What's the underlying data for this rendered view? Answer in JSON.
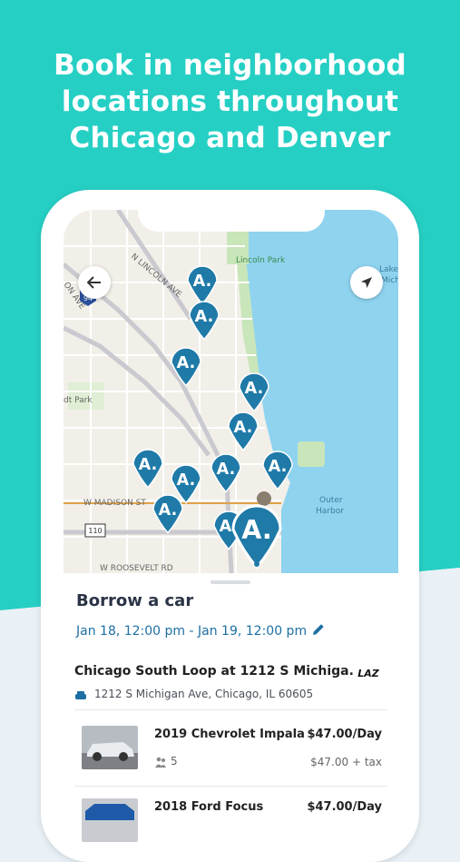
{
  "headline": {
    "line1": "Book in neighborhood",
    "line2": "locations throughout",
    "line3": "Chicago and Denver"
  },
  "map": {
    "labels": {
      "lincoln_park": "Lincoln Park",
      "lake": "Lake",
      "lake2": "Mich",
      "n_lincoln_ave": "N LINCOLN AVE",
      "on_ave": "ON AVE",
      "dt_park": "dt Park",
      "w_madison": "W MADISON ST",
      "w_roosevelt": "W ROOSEVELT RD",
      "outer_harbor1": "Outer",
      "outer_harbor2": "Harbor",
      "i94": "94",
      "r110": "110"
    },
    "pin_glyph": "A."
  },
  "sheet": {
    "title": "Borrow a car",
    "dates": "Jan 18, 12:00 pm - Jan 19, 12:00 pm",
    "location_name": "Chicago South Loop at 1212 S Michiga...",
    "partner_logo": "LAZ",
    "address": "1212 S Michigan Ave, Chicago, IL 60605",
    "cars": [
      {
        "name": "2019 Chevrolet Impala",
        "price": "$47.00/Day",
        "seats": "5",
        "price_tax": "$47.00 + tax"
      },
      {
        "name": "2018 Ford Focus",
        "price": "$47.00/Day"
      }
    ]
  },
  "colors": {
    "teal": "#26cfc4",
    "pin": "#1f7aa8",
    "link": "#1d6fa3",
    "water": "#8fd3ef"
  }
}
